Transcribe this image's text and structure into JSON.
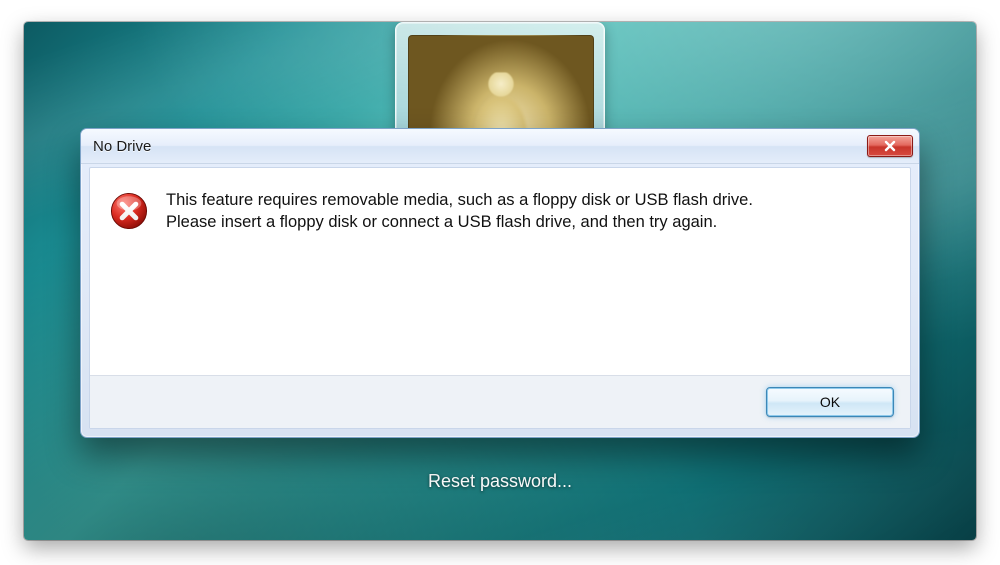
{
  "login": {
    "reset_link": "Reset password..."
  },
  "dialog": {
    "title": "No Drive",
    "message": "This feature requires removable media, such as a floppy disk or USB flash drive. Please insert a floppy disk or connect a USB flash drive, and then try again.",
    "ok_label": "OK",
    "icon": "error-icon"
  }
}
